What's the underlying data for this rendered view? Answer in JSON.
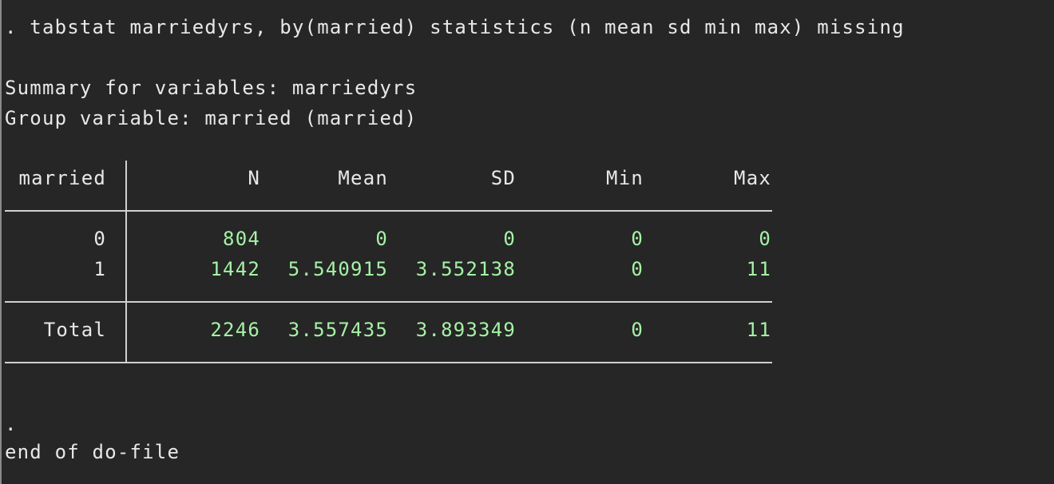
{
  "console": {
    "command": ". tabstat marriedyrs, by(married) statistics (n mean sd min max) missing",
    "summary_line": "Summary for variables: marriedyrs",
    "group_line": "Group variable: married (married)",
    "end_dot": ".",
    "end_text": "end of do-file"
  },
  "table": {
    "headers": [
      "married",
      "N",
      "Mean",
      "SD",
      "Min",
      "Max"
    ],
    "rows": [
      [
        "0",
        "804",
        "0",
        "0",
        "0",
        "0"
      ],
      [
        "1",
        "1442",
        "5.540915",
        "3.552138",
        "0",
        "11"
      ]
    ],
    "total": [
      "Total",
      "2246",
      "3.557435",
      "3.893349",
      "0",
      "11"
    ]
  },
  "colors": {
    "background": "#262626",
    "text": "#e8e8e8",
    "numbers": "#a5f2a5"
  }
}
